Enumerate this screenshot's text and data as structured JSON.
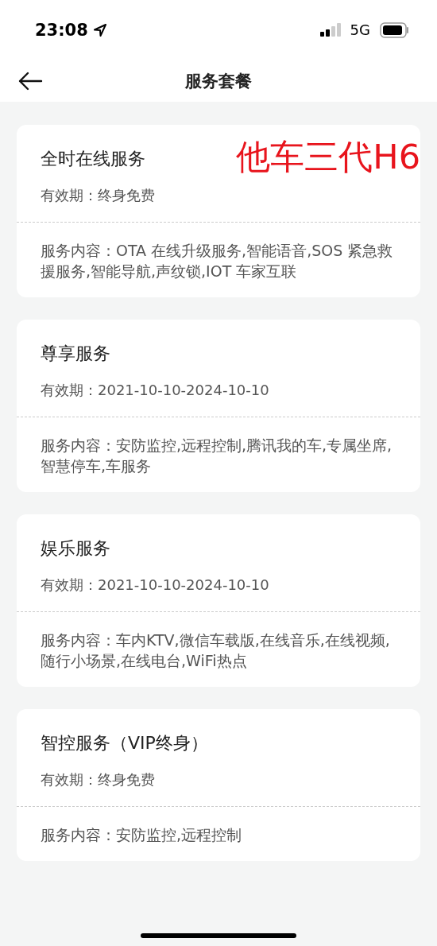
{
  "status_bar": {
    "time": "23:08",
    "network": "5G"
  },
  "nav": {
    "title": "服务套餐"
  },
  "annotation": "他车三代H6",
  "packages": [
    {
      "name": "全时在线服务",
      "validity": "有效期：终身免费",
      "content": "服务内容：OTA 在线升级服务,智能语音,SOS 紧急救援服务,智能导航,声纹锁,IOT 车家互联"
    },
    {
      "name": "尊享服务",
      "validity": "有效期：2021-10-10-2024-10-10",
      "content": "服务内容：安防监控,远程控制,腾讯我的车,专属坐席,智慧停车,车服务"
    },
    {
      "name": "娱乐服务",
      "validity": "有效期：2021-10-10-2024-10-10",
      "content": "服务内容：车内KTV,微信车载版,在线音乐,在线视频,随行小场景,在线电台,WiFi热点"
    },
    {
      "name": "智控服务（VIP终身）",
      "validity": "有效期：终身免费",
      "content": "服务内容：安防监控,远程控制"
    }
  ]
}
